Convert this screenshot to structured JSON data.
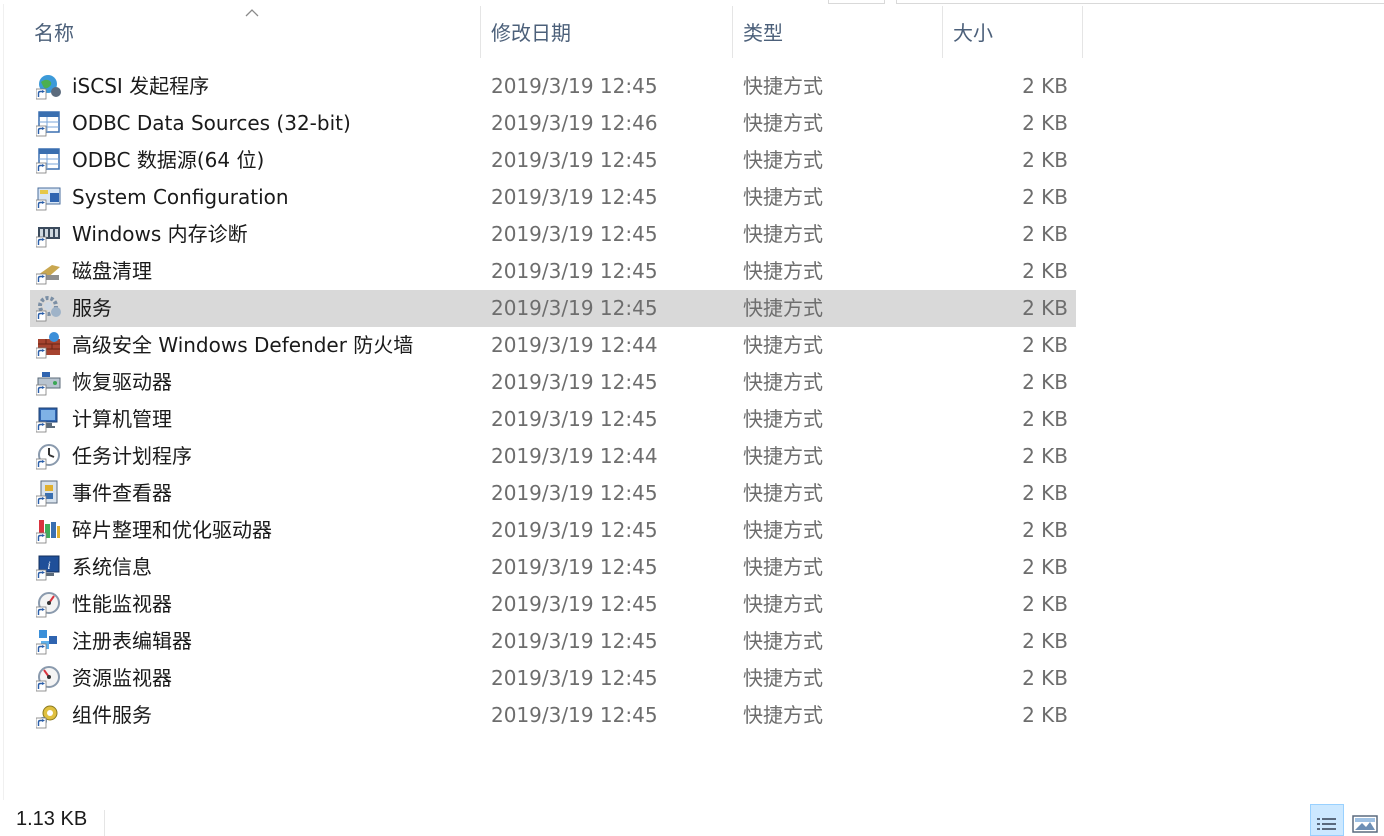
{
  "columns": {
    "name": "名称",
    "modified": "修改日期",
    "type": "类型",
    "size": "大小"
  },
  "files": [
    {
      "name": "iSCSI 发起程序",
      "modified": "2019/3/19 12:45",
      "type": "快捷方式",
      "size": "2 KB",
      "icon": "iscsi-globe-icon",
      "selected": false
    },
    {
      "name": "ODBC Data Sources (32-bit)",
      "modified": "2019/3/19 12:46",
      "type": "快捷方式",
      "size": "2 KB",
      "icon": "odbc-table-icon",
      "selected": false
    },
    {
      "name": "ODBC 数据源(64 位)",
      "modified": "2019/3/19 12:45",
      "type": "快捷方式",
      "size": "2 KB",
      "icon": "odbc-table-icon",
      "selected": false
    },
    {
      "name": "System Configuration",
      "modified": "2019/3/19 12:45",
      "type": "快捷方式",
      "size": "2 KB",
      "icon": "system-config-icon",
      "selected": false
    },
    {
      "name": "Windows 内存诊断",
      "modified": "2019/3/19 12:45",
      "type": "快捷方式",
      "size": "2 KB",
      "icon": "memory-chip-icon",
      "selected": false
    },
    {
      "name": "磁盘清理",
      "modified": "2019/3/19 12:45",
      "type": "快捷方式",
      "size": "2 KB",
      "icon": "disk-cleanup-icon",
      "selected": false
    },
    {
      "name": "服务",
      "modified": "2019/3/19 12:45",
      "type": "快捷方式",
      "size": "2 KB",
      "icon": "services-gear-icon",
      "selected": true
    },
    {
      "name": "高级安全 Windows Defender 防火墙",
      "modified": "2019/3/19 12:44",
      "type": "快捷方式",
      "size": "2 KB",
      "icon": "firewall-brick-icon",
      "selected": false
    },
    {
      "name": "恢复驱动器",
      "modified": "2019/3/19 12:45",
      "type": "快捷方式",
      "size": "2 KB",
      "icon": "recovery-drive-icon",
      "selected": false
    },
    {
      "name": "计算机管理",
      "modified": "2019/3/19 12:45",
      "type": "快捷方式",
      "size": "2 KB",
      "icon": "computer-management-icon",
      "selected": false
    },
    {
      "name": "任务计划程序",
      "modified": "2019/3/19 12:44",
      "type": "快捷方式",
      "size": "2 KB",
      "icon": "task-scheduler-clock-icon",
      "selected": false
    },
    {
      "name": "事件查看器",
      "modified": "2019/3/19 12:45",
      "type": "快捷方式",
      "size": "2 KB",
      "icon": "event-viewer-icon",
      "selected": false
    },
    {
      "name": "碎片整理和优化驱动器",
      "modified": "2019/3/19 12:45",
      "type": "快捷方式",
      "size": "2 KB",
      "icon": "defrag-icon",
      "selected": false
    },
    {
      "name": "系统信息",
      "modified": "2019/3/19 12:45",
      "type": "快捷方式",
      "size": "2 KB",
      "icon": "system-info-icon",
      "selected": false
    },
    {
      "name": "性能监视器",
      "modified": "2019/3/19 12:45",
      "type": "快捷方式",
      "size": "2 KB",
      "icon": "performance-gauge-icon",
      "selected": false
    },
    {
      "name": "注册表编辑器",
      "modified": "2019/3/19 12:45",
      "type": "快捷方式",
      "size": "2 KB",
      "icon": "registry-cubes-icon",
      "selected": false
    },
    {
      "name": "资源监视器",
      "modified": "2019/3/19 12:45",
      "type": "快捷方式",
      "size": "2 KB",
      "icon": "resource-gauge-icon",
      "selected": false
    },
    {
      "name": "组件服务",
      "modified": "2019/3/19 12:45",
      "type": "快捷方式",
      "size": "2 KB",
      "icon": "component-services-icon",
      "selected": false
    }
  ],
  "status": {
    "selection_size": "1.13 KB"
  },
  "colors": {
    "selected_row": "#d9d9d9",
    "header_text": "#4c607a",
    "detail_text": "#6d6d6d",
    "view_active": "#cce8ff"
  }
}
